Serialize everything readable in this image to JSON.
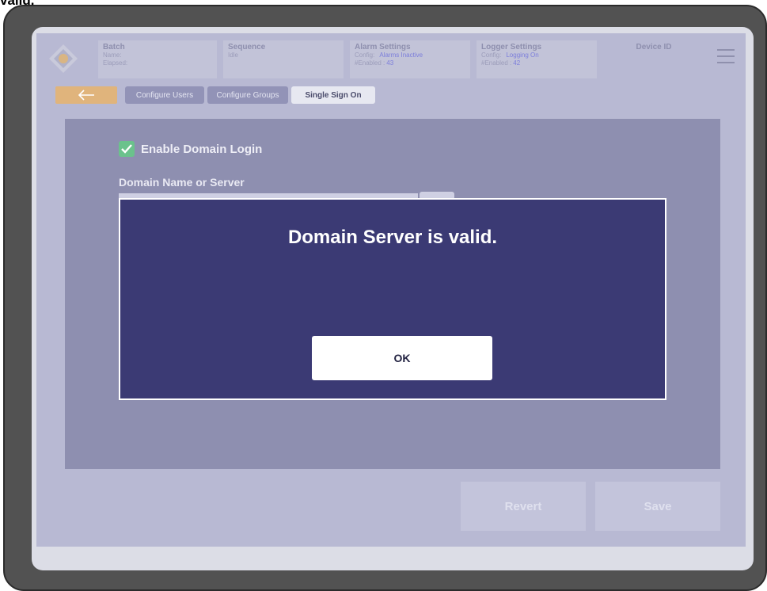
{
  "page_caption": "valid.",
  "header": {
    "batch": {
      "title": "Batch",
      "name_label": "Name:",
      "elapsed_label": "Elapsed:"
    },
    "sequence": {
      "title": "Sequence",
      "status": "Idle"
    },
    "alarm": {
      "title": "Alarm Settings",
      "config_label": "Config:",
      "config_value": "Alarms Inactive",
      "enabled_label": "#Enabled :",
      "enabled_value": "43"
    },
    "logger": {
      "title": "Logger Settings",
      "config_label": "Config:",
      "config_value": "Logging On",
      "enabled_label": "#Enabled :",
      "enabled_value": "42"
    },
    "device": {
      "title": "Device ID"
    }
  },
  "tabs": [
    {
      "label": "Configure Users"
    },
    {
      "label": "Configure Groups"
    },
    {
      "label": "Single Sign On"
    }
  ],
  "form": {
    "enable_domain_login_label": "Enable Domain Login",
    "enable_domain_login_checked": true,
    "domain_field_label": "Domain Name or Server"
  },
  "footer": {
    "revert_label": "Revert",
    "save_label": "Save"
  },
  "dialog": {
    "message": "Domain Server is valid.",
    "ok_label": "OK"
  },
  "colors": {
    "accent": "#e0b47c",
    "dialog_bg": "#3b3a74",
    "checkbox": "#6bc28c"
  }
}
